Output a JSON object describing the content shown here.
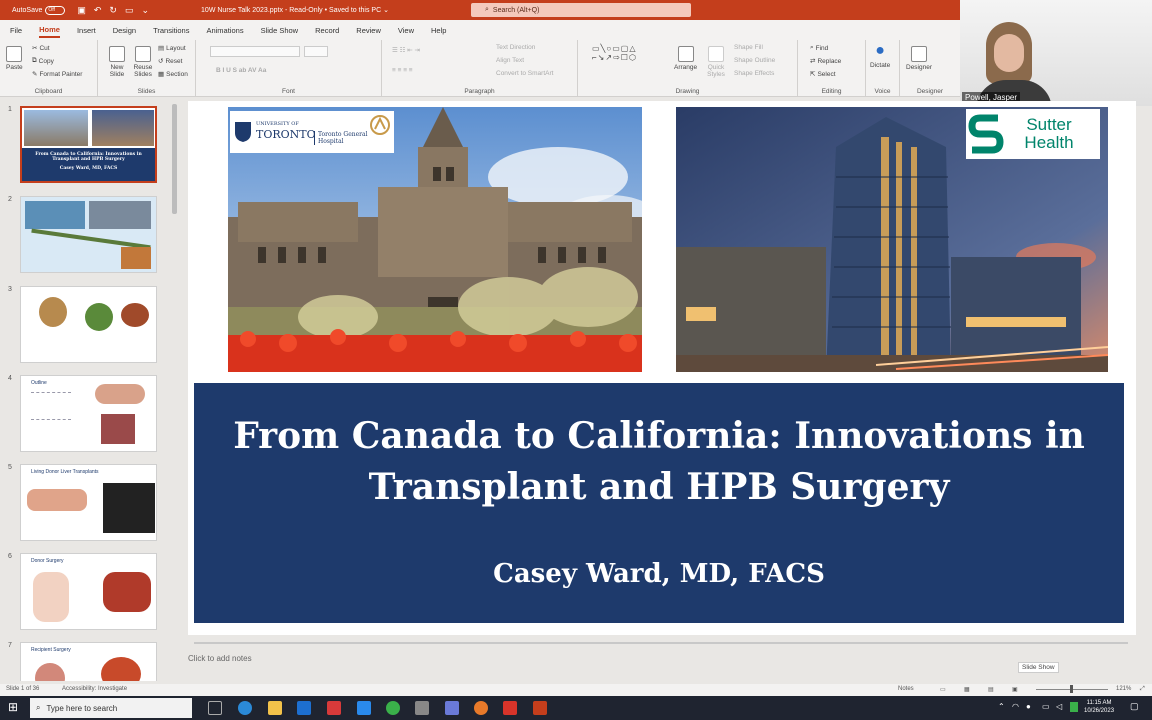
{
  "titlebar": {
    "autosave_label": "AutoSave",
    "autosave_state": "Off",
    "doc_title": "10W Nurse Talk 2023.pptx  -  Read-Only  •  Saved to this PC  ⌄",
    "search_placeholder": "Search (Alt+Q)"
  },
  "ribbon": {
    "tabs": [
      "File",
      "Home",
      "Insert",
      "Design",
      "Transitions",
      "Animations",
      "Slide Show",
      "Record",
      "Review",
      "View",
      "Help"
    ],
    "active_tab": "Home",
    "clipboard": {
      "paste": "Paste",
      "cut": "Cut",
      "copy": "Copy",
      "format_painter": "Format Painter",
      "label": "Clipboard"
    },
    "slides": {
      "new_slide": "New Slide",
      "reuse": "Reuse Slides",
      "layout": "Layout",
      "reset": "Reset",
      "section": "Section",
      "label": "Slides"
    },
    "font": {
      "label": "Font",
      "styles": "B  I  U  S  ab  AV  Aa"
    },
    "paragraph": {
      "label": "Paragraph",
      "text_direction": "Text Direction",
      "align_text": "Align Text",
      "convert": "Convert to SmartArt"
    },
    "drawing": {
      "label": "Drawing",
      "arrange": "Arrange",
      "quick_styles": "Quick Styles",
      "shape_fill": "Shape Fill",
      "shape_outline": "Shape Outline",
      "shape_effects": "Shape Effects"
    },
    "editing": {
      "label": "Editing",
      "find": "Find",
      "replace": "Replace",
      "select": "Select"
    },
    "voice": {
      "label": "Voice",
      "dictate": "Dictate"
    },
    "designer": {
      "label": "Designer",
      "designer_btn": "Designer"
    }
  },
  "webcam": {
    "name": "Powell, Jasper"
  },
  "thumbnails": [
    {
      "num": "1",
      "title": "From Canada to California: Innovations in Transplant and HPB Surgery",
      "subtitle": "Casey Ward, MD, FACS"
    },
    {
      "num": "2",
      "title": ""
    },
    {
      "num": "3",
      "title": ""
    },
    {
      "num": "4",
      "title": "Outline"
    },
    {
      "num": "5",
      "title": "Living Donor Liver Transplants"
    },
    {
      "num": "6",
      "title": "Donor Surgery"
    },
    {
      "num": "7",
      "title": "Recipient Surgery"
    }
  ],
  "slide": {
    "title": "From Canada to California: Innovations in Transplant and HPB Surgery",
    "author": "Casey Ward, MD, FACS",
    "logo_left_univ": "UNIVERSITY OF",
    "logo_left_name": "TORONTO",
    "logo_left_hospital": "Toronto General Hospital",
    "logo_right": "Sutter Health"
  },
  "notes_placeholder": "Click to add notes",
  "slideshow_tooltip": "Slide Show",
  "statusbar": {
    "slide_count": "Slide 1 of 36",
    "accessibility": "Accessibility: Investigate",
    "notes": "Notes",
    "zoom": "121%"
  },
  "taskbar": {
    "search_placeholder": "Type here to search",
    "time": "11:15 AM",
    "date": "10/26/2023"
  },
  "colors": {
    "ppt_accent": "#c43e1c",
    "banner": "#1e3a6c",
    "taskbar": "#1f2430"
  }
}
